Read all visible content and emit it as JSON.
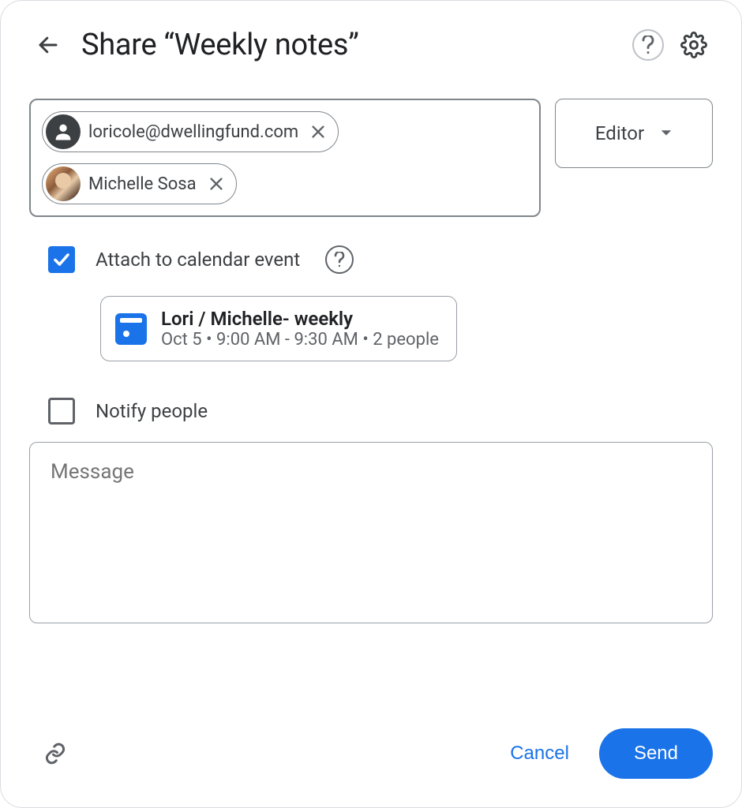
{
  "header": {
    "title": "Share “Weekly notes”"
  },
  "people": {
    "chips": [
      {
        "label": "loricole@dwellingfund.com",
        "avatar_type": "generic"
      },
      {
        "label": "Michelle Sosa",
        "avatar_type": "photo"
      }
    ],
    "role": "Editor"
  },
  "attach": {
    "checked": true,
    "label": "Attach to calendar event",
    "event": {
      "title": "Lori / Michelle- weekly",
      "subtitle": "Oct 5 • 9:00 AM - 9:30 AM • 2 people"
    }
  },
  "notify": {
    "checked": false,
    "label": "Notify people"
  },
  "message": {
    "placeholder": "Message"
  },
  "footer": {
    "cancel": "Cancel",
    "send": "Send"
  }
}
